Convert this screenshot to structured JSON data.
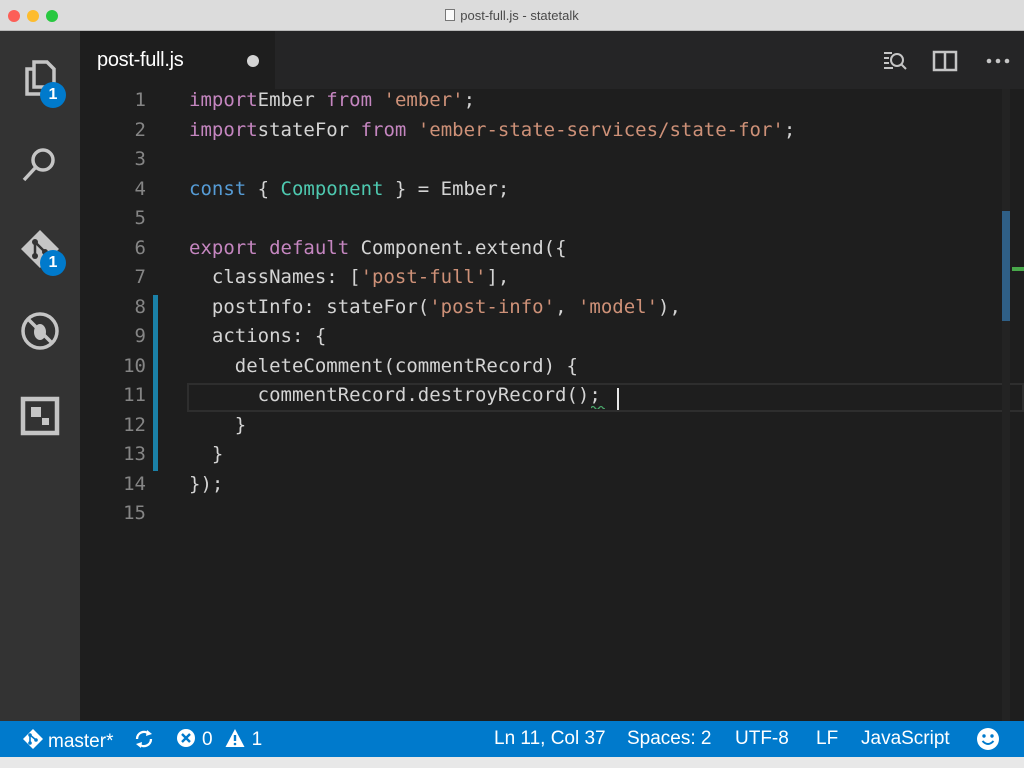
{
  "window": {
    "title": "post-full.js - statetalk"
  },
  "activity_bar": {
    "explorer_badge": "1",
    "scm_badge": "1",
    "items": [
      "explorer-icon",
      "search-icon",
      "git-icon",
      "debug-icon",
      "extensions-icon"
    ]
  },
  "tab": {
    "label": "post-full.js",
    "dirty": true
  },
  "editor": {
    "line_numbers": [
      "1",
      "2",
      "3",
      "4",
      "5",
      "6",
      "7",
      "8",
      "9",
      "10",
      "11",
      "12",
      "13",
      "14",
      "15"
    ],
    "lines": [
      [
        [
          "k",
          "import"
        ],
        [
          "",
          "Ember "
        ],
        [
          "k",
          "from"
        ],
        [
          "",
          " "
        ],
        [
          "s",
          "'ember'"
        ],
        [
          "",
          ";"
        ]
      ],
      [
        [
          "k",
          "import"
        ],
        [
          "",
          "stateFor "
        ],
        [
          "k",
          "from"
        ],
        [
          "",
          " "
        ],
        [
          "s",
          "'ember-state-services/state-for'"
        ],
        [
          "",
          ";"
        ]
      ],
      [],
      [
        [
          "b",
          "const"
        ],
        [
          "",
          ""
        ],
        [
          "",
          " { "
        ],
        [
          "t",
          "Component"
        ],
        [
          "",
          " } = Ember;"
        ]
      ],
      [],
      [
        [
          "k",
          "export"
        ],
        [
          "",
          " "
        ],
        [
          "k",
          "default"
        ],
        [
          "",
          " Component.extend({"
        ]
      ],
      [
        [
          "",
          "  classNames: ["
        ],
        [
          "s",
          "'post-full'"
        ],
        [
          "",
          "],"
        ]
      ],
      [
        [
          "",
          "  postInfo: stateFor("
        ],
        [
          "s",
          "'post-info'"
        ],
        [
          "",
          ", "
        ],
        [
          "s",
          "'model'"
        ],
        [
          "",
          "),"
        ]
      ],
      [
        [
          "",
          "  actions: {"
        ]
      ],
      [
        [
          "",
          "    deleteComment(commentRecord) {"
        ]
      ],
      [
        [
          "",
          "      commentRecord.destroyRecord();"
        ]
      ],
      [
        [
          "",
          "    }"
        ]
      ],
      [
        [
          "",
          "  }"
        ]
      ],
      [
        [
          "",
          "});"
        ]
      ],
      []
    ],
    "cursor_line": 11,
    "cursor_col": 37
  },
  "status_bar": {
    "branch": "master*",
    "errors": "0",
    "warnings": "1",
    "position": "Ln 11, Col 37",
    "indent": "Spaces: 2",
    "encoding": "UTF-8",
    "eol": "LF",
    "language": "JavaScript"
  },
  "colors": {
    "accent": "#007acc",
    "editor_bg": "#1e1e1e",
    "keyword": "#c586c0",
    "string": "#ce9178",
    "storage": "#569cd6",
    "type": "#4ec9b0",
    "modified_gutter": "#1b81a8"
  }
}
